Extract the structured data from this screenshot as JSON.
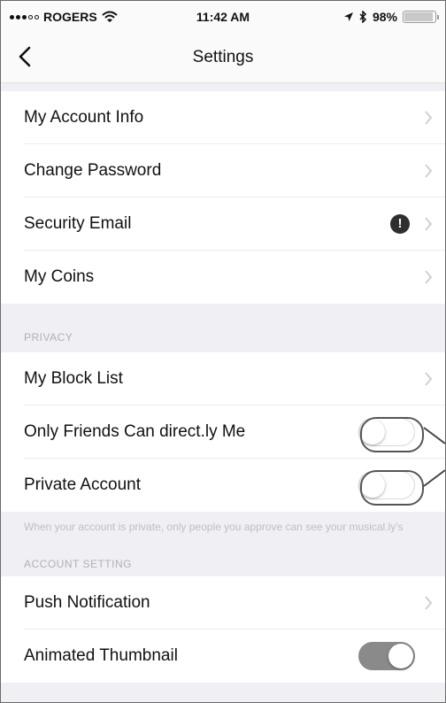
{
  "status_bar": {
    "carrier": "ROGERS",
    "time": "11:42 AM",
    "battery": "98%",
    "battery_level": 0.98,
    "icons": [
      "signal-icon",
      "wifi-icon",
      "location-icon",
      "bluetooth-icon",
      "battery-icon"
    ]
  },
  "nav": {
    "title": "Settings",
    "back_icon": "chevron-left-icon"
  },
  "account_group": [
    {
      "label": "My Account Info"
    },
    {
      "label": "Change Password"
    },
    {
      "label": "Security Email",
      "badge": "!"
    },
    {
      "label": "My Coins"
    }
  ],
  "privacy": {
    "header": "PRIVACY",
    "rows": [
      {
        "label": "My Block List"
      },
      {
        "label": "Only Friends Can direct.ly Me",
        "toggle": false
      },
      {
        "label": "Private Account",
        "toggle": false
      }
    ],
    "note": "When your account is private, only people you approve can see your musical.ly's"
  },
  "account_setting": {
    "header": "ACCOUNT SETTING",
    "rows": [
      {
        "label": "Push Notification"
      },
      {
        "label": "Animated Thumbnail",
        "toggle": true
      }
    ]
  },
  "colors": {
    "background": "#efeff4",
    "toggle_on": "#8a8a8a",
    "badge": "#2f2f2f"
  }
}
